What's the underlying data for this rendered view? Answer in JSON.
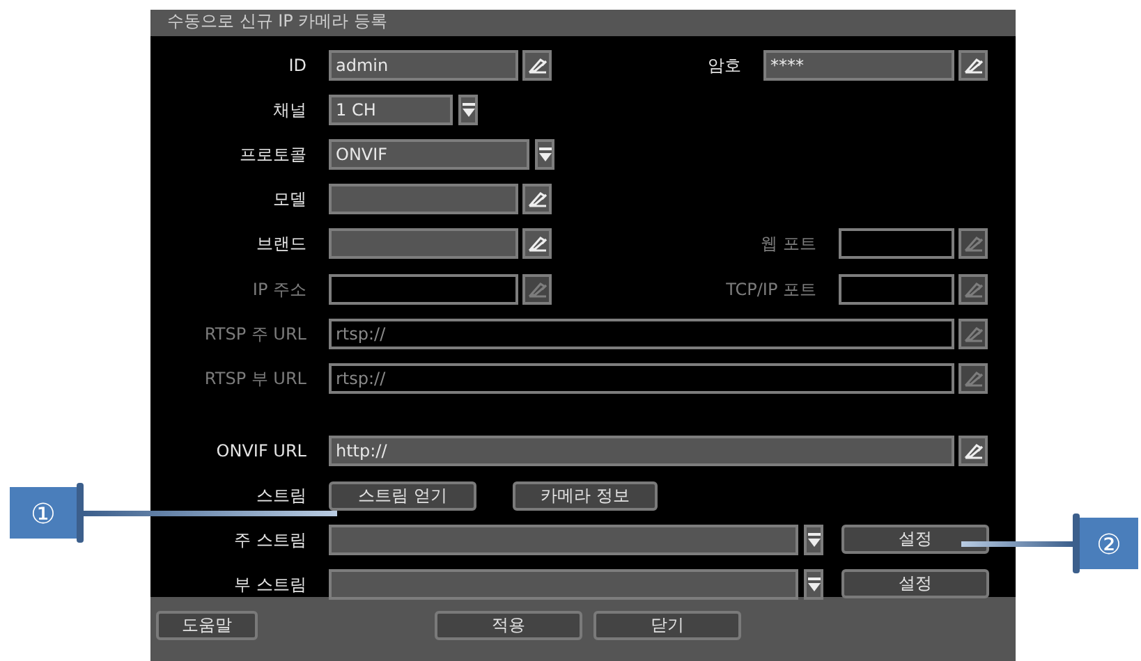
{
  "window": {
    "title": "수동으로 신규 IP 카메라 등록"
  },
  "rows": [
    {
      "fields": [
        {
          "label": "ID",
          "kind": "text",
          "value": "admin",
          "disabled": false
        },
        {
          "label": "암호",
          "kind": "text",
          "value": "****",
          "disabled": false
        }
      ]
    },
    {
      "fields": [
        {
          "label": "채널",
          "kind": "combo",
          "value": "1 CH",
          "disabled": false
        }
      ]
    },
    {
      "fields": [
        {
          "label": "프로토콜",
          "kind": "combo",
          "value": "ONVIF",
          "disabled": false
        }
      ]
    },
    {
      "fields": [
        {
          "label": "모델",
          "kind": "text",
          "disabled": false
        }
      ]
    },
    {
      "fields": [
        {
          "label": "브랜드",
          "kind": "text",
          "disabled": false
        },
        {
          "label": "웹 포트",
          "kind": "text",
          "disabled": true
        }
      ]
    },
    {
      "fields": [
        {
          "label": "IP 주소",
          "kind": "text",
          "disabled": true
        },
        {
          "label": "TCP/IP 포트",
          "kind": "text",
          "disabled": true
        }
      ]
    },
    {
      "fields": [
        {
          "label": "RTSP 주 URL",
          "kind": "text",
          "value": "rtsp://",
          "disabled": true
        }
      ]
    },
    {
      "fields": [
        {
          "label": "RTSP 부 URL",
          "kind": "text",
          "value": "rtsp://",
          "disabled": true
        }
      ]
    },
    {
      "fields": [
        {
          "label": "ONVIF URL",
          "kind": "text",
          "value": "http://",
          "disabled": false
        }
      ]
    },
    {
      "fields": [
        {
          "label": "스트림",
          "kind": "buttons",
          "buttons": [
            "스트림 얻기",
            "카메라 정보"
          ]
        }
      ]
    },
    {
      "fields": [
        {
          "label": "주 스트림",
          "kind": "combo",
          "button": "설정",
          "disabled": false
        }
      ]
    },
    {
      "fields": [
        {
          "label": "부 스트림",
          "kind": "combo",
          "button": "설정",
          "disabled": false
        }
      ]
    }
  ],
  "footer": {
    "buttons": [
      "도움말",
      "적용",
      "닫기"
    ]
  },
  "callouts": [
    {
      "label": "①"
    },
    {
      "label": "②"
    }
  ]
}
